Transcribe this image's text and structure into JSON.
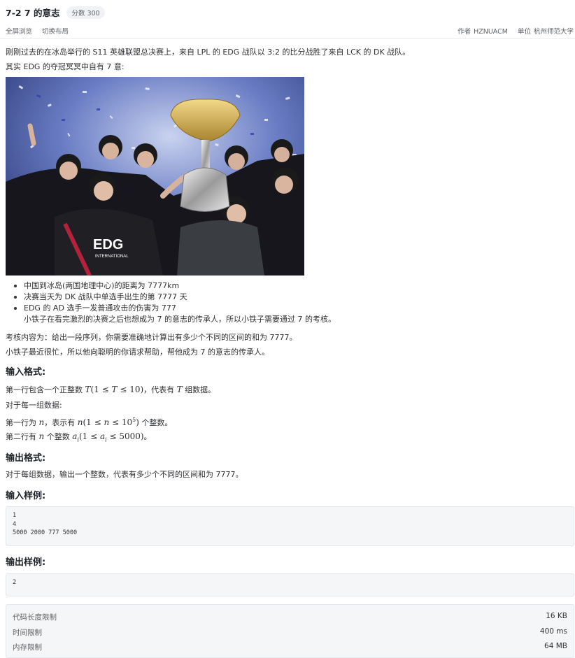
{
  "problem": {
    "title": "7-2 7 的意志",
    "score": "分数 300",
    "toolbar": [
      "全屏浏览",
      "切换布局"
    ],
    "author_label": "作者",
    "author": "HZNUACM",
    "org_label": "单位",
    "org": "杭州师范大学"
  },
  "intro": {
    "p1": "刚刚过去的在冰岛举行的 S11 英雄联盟总决赛上，来自 LPL 的 EDG 战队以 3:2 的比分战胜了来自 LCK 的 DK 战队。",
    "p2": "其实 EDG 的夺冠冥冥中自有 7 意:"
  },
  "photo": {
    "jersey_text": "EDG",
    "jersey_sub": "INTERNATIONAL"
  },
  "bullets": [
    "中国到冰岛(两国地理中心)的距离为 7777km",
    "决赛当天为 DK 战队中单选手出生的第 7777 天",
    "EDG 的 AD 选手一发普通攻击的伤害为 777"
  ],
  "bullet_tail": "小铁子在看完激烈的决赛之后也想成为 7 的意志的传承人，所以小铁子需要通过 7 的考核。",
  "task": {
    "p1": "考核内容为：给出一段序列，你需要准确地计算出有多少个不同的区间的和为 7777。",
    "p2": "小铁子最近很忙，所以他向聪明的你请求帮助，帮他成为 7 的意志的传承人。"
  },
  "input_format": {
    "heading": "输入格式:",
    "l1_pre": "第一行包含一个正整数",
    "l1_post": "，代表有",
    "l1_end": "组数据。",
    "l2": "对于每一组数据:",
    "l3_pre": "第一行为",
    "l3_mid": "，表示有",
    "l3_end": "个整数。",
    "l4_pre": "第二行有",
    "l4_mid": "个整数",
    "l4_end": "。"
  },
  "output_format": {
    "heading": "输出格式:",
    "text": "对于每组数据，输出一个整数，代表有多少个不同的区间和为 7777。"
  },
  "sample_input": {
    "heading": "输入样例:",
    "code": "1\n4\n5000 2000 777 5000"
  },
  "sample_output": {
    "heading": "输出样例:",
    "code": "2"
  },
  "limits": [
    {
      "label": "代码长度限制",
      "value": "16 KB"
    },
    {
      "label": "时间限制",
      "value": "400 ms"
    },
    {
      "label": "内存限制",
      "value": "64 MB"
    }
  ]
}
